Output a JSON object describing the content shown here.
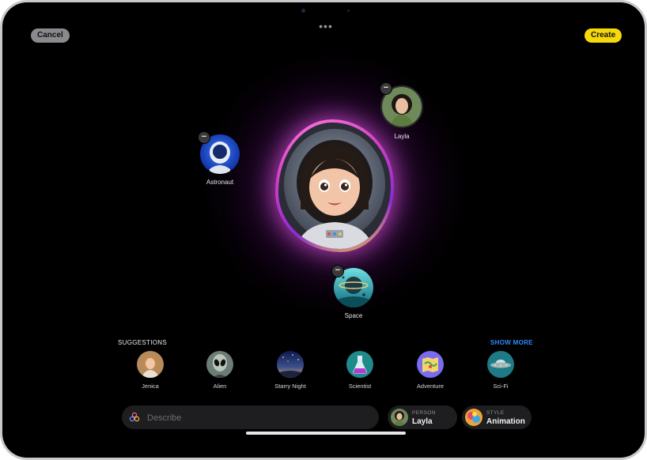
{
  "toolbar": {
    "cancel_label": "Cancel",
    "create_label": "Create",
    "more_label": "•••"
  },
  "concepts": [
    {
      "label": "Layla",
      "icon": "person-photo-icon"
    },
    {
      "label": "Astronaut",
      "icon": "astronaut-helmet-icon"
    },
    {
      "label": "Space",
      "icon": "planet-icon"
    }
  ],
  "suggestions": {
    "title": "SUGGESTIONS",
    "show_more": "SHOW MORE",
    "items": [
      {
        "label": "Jenica",
        "icon": "person-photo-icon"
      },
      {
        "label": "Alien",
        "icon": "alien-icon"
      },
      {
        "label": "Starry Night",
        "icon": "starry-night-icon"
      },
      {
        "label": "Scientist",
        "icon": "flask-icon"
      },
      {
        "label": "Adventure",
        "icon": "map-icon"
      },
      {
        "label": "Sci-Fi",
        "icon": "spaceship-icon"
      }
    ]
  },
  "describe": {
    "placeholder": "Describe"
  },
  "person_chip": {
    "caption": "PERSON",
    "value": "Layla"
  },
  "style_chip": {
    "caption": "STYLE",
    "value": "Animation"
  },
  "colors": {
    "accent_blue": "#2f8cff",
    "create_yellow": "#f5d90a",
    "glow_pink": "#d43ec8"
  }
}
